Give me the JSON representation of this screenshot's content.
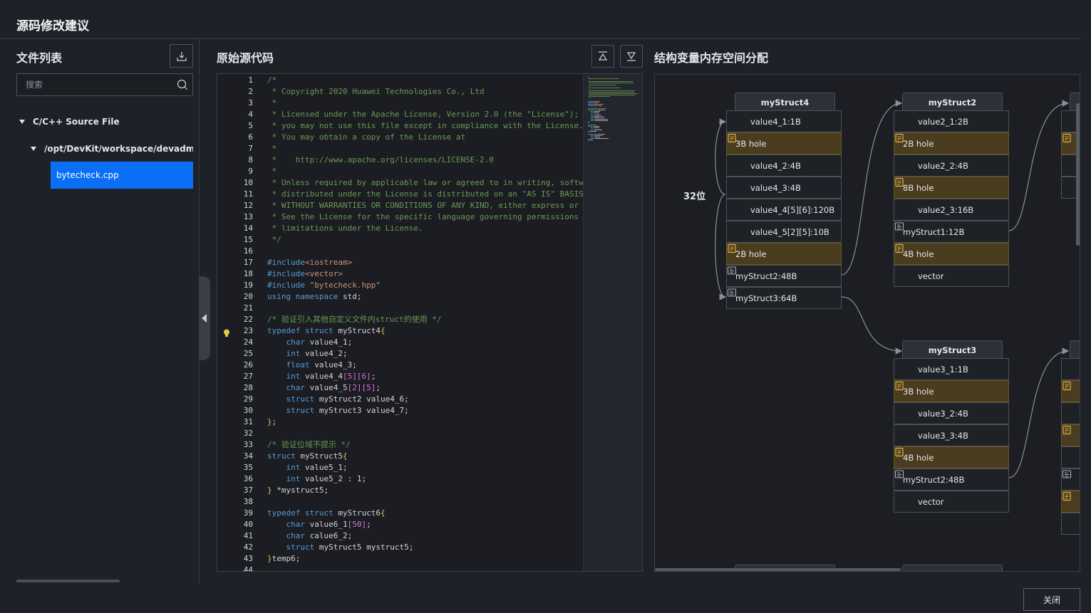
{
  "dialog": {
    "title": "源码修改建议",
    "close_label": "关闭"
  },
  "file_panel": {
    "title": "文件列表",
    "search_placeholder": "搜索",
    "tree": {
      "root_label": "C/C++ Source File",
      "folder_label": "/opt/DevKit/workspace/devadmin/at",
      "selected_file": "bytecheck.cpp"
    }
  },
  "code_panel": {
    "title": "原始源代码",
    "hint_line": 23,
    "lines": [
      [
        [
          "c-cm",
          "/*"
        ]
      ],
      [
        [
          "c-cm",
          " * Copyright 2020 Huawei Technologies Co., Ltd"
        ]
      ],
      [
        [
          "c-cm",
          " *"
        ]
      ],
      [
        [
          "c-cm",
          " * Licensed under the Apache License, Version 2.0 (the \"License\");"
        ]
      ],
      [
        [
          "c-cm",
          " * you may not use this file except in compliance with the License."
        ]
      ],
      [
        [
          "c-cm",
          " * You may obtain a copy of the License at"
        ]
      ],
      [
        [
          "c-cm",
          " *"
        ]
      ],
      [
        [
          "c-cm",
          " *    http://www.apache.org/licenses/LICENSE-2.0"
        ]
      ],
      [
        [
          "c-cm",
          " *"
        ]
      ],
      [
        [
          "c-cm",
          " * Unless required by applicable law or agreed to in writing, software"
        ]
      ],
      [
        [
          "c-cm",
          " * distributed under the License is distributed on an \"AS IS\" BASIS,"
        ]
      ],
      [
        [
          "c-cm",
          " * WITHOUT WARRANTIES OR CONDITIONS OF ANY KIND, either express or implied."
        ]
      ],
      [
        [
          "c-cm",
          " * See the License for the specific language governing permissions and"
        ]
      ],
      [
        [
          "c-cm",
          " * limitations under the License."
        ]
      ],
      [
        [
          "c-cm",
          " */"
        ]
      ],
      [],
      [
        [
          "c-pp",
          "#include"
        ],
        [
          "c-st",
          "<iostream>"
        ]
      ],
      [
        [
          "c-pp",
          "#include"
        ],
        [
          "c-st",
          "<vector>"
        ]
      ],
      [
        [
          "c-pp",
          "#include "
        ],
        [
          "c-st",
          "\"bytecheck.hpp\""
        ]
      ],
      [
        [
          "c-kw",
          "using namespace"
        ],
        [
          "c-tx",
          " std;"
        ]
      ],
      [],
      [
        [
          "c-cm",
          "/* 验证引入其他自定义文件内struct的使用 */"
        ]
      ],
      [
        [
          "c-kw",
          "typedef struct"
        ],
        [
          "c-tx",
          " myStruct4"
        ],
        [
          "c-pu",
          "{"
        ]
      ],
      [
        [
          "c-tx",
          "    "
        ],
        [
          "c-kw",
          "char"
        ],
        [
          "c-tx",
          " value4_1;"
        ]
      ],
      [
        [
          "c-tx",
          "    "
        ],
        [
          "c-kw",
          "int"
        ],
        [
          "c-tx",
          " value4_2;"
        ]
      ],
      [
        [
          "c-tx",
          "    "
        ],
        [
          "c-kw",
          "float"
        ],
        [
          "c-tx",
          " value4_3;"
        ]
      ],
      [
        [
          "c-tx",
          "    "
        ],
        [
          "c-kw",
          "int"
        ],
        [
          "c-tx",
          " value4_4"
        ],
        [
          "c-br",
          "[5][6]"
        ],
        [
          "c-tx",
          ";"
        ]
      ],
      [
        [
          "c-tx",
          "    "
        ],
        [
          "c-kw",
          "char"
        ],
        [
          "c-tx",
          " value4_5"
        ],
        [
          "c-br",
          "[2][5]"
        ],
        [
          "c-tx",
          ";"
        ]
      ],
      [
        [
          "c-tx",
          "    "
        ],
        [
          "c-kw",
          "struct"
        ],
        [
          "c-tx",
          " myStruct2 value4_6;"
        ]
      ],
      [
        [
          "c-tx",
          "    "
        ],
        [
          "c-kw",
          "struct"
        ],
        [
          "c-tx",
          " myStruct3 value4_7;"
        ]
      ],
      [
        [
          "c-pu",
          "}"
        ],
        [
          "c-tx",
          ";"
        ]
      ],
      [],
      [
        [
          "c-cm",
          "/* 验证位域不提示 */"
        ]
      ],
      [
        [
          "c-kw",
          "struct"
        ],
        [
          "c-tx",
          " myStruct5"
        ],
        [
          "c-pu",
          "{"
        ]
      ],
      [
        [
          "c-tx",
          "    "
        ],
        [
          "c-kw",
          "int"
        ],
        [
          "c-tx",
          " value5_1;"
        ]
      ],
      [
        [
          "c-tx",
          "    "
        ],
        [
          "c-kw",
          "int"
        ],
        [
          "c-tx",
          " value5_2 : 1;"
        ]
      ],
      [
        [
          "c-pu",
          "}"
        ],
        [
          "c-tx",
          " *mystruct5;"
        ]
      ],
      [],
      [
        [
          "c-kw",
          "typedef struct"
        ],
        [
          "c-tx",
          " myStruct6"
        ],
        [
          "c-pu",
          "{"
        ]
      ],
      [
        [
          "c-tx",
          "    "
        ],
        [
          "c-kw",
          "char"
        ],
        [
          "c-tx",
          " value6_1"
        ],
        [
          "c-br",
          "[50]"
        ],
        [
          "c-tx",
          ";"
        ]
      ],
      [
        [
          "c-tx",
          "    "
        ],
        [
          "c-kw",
          "char"
        ],
        [
          "c-tx",
          " calue6_2;"
        ]
      ],
      [
        [
          "c-tx",
          "    "
        ],
        [
          "c-kw",
          "struct"
        ],
        [
          "c-tx",
          " myStruct5 mystruct5;"
        ]
      ],
      [
        [
          "c-pu",
          "}"
        ],
        [
          "c-tx",
          "temp6;"
        ]
      ],
      []
    ]
  },
  "struct_panel": {
    "title": "结构变量内存空间分配",
    "bit_label": "32位",
    "structs": [
      {
        "name": "myStruct4",
        "rows": [
          {
            "t": "plain",
            "label": "value4_1:1B"
          },
          {
            "t": "hole",
            "label": "3B hole"
          },
          {
            "t": "plain",
            "label": "value4_2:4B"
          },
          {
            "t": "plain",
            "label": "value4_3:4B"
          },
          {
            "t": "plain",
            "label": "value4_4[5][6]:120B"
          },
          {
            "t": "plain",
            "label": "value4_5[2][5]:10B"
          },
          {
            "t": "hole",
            "label": "2B hole"
          },
          {
            "t": "ref",
            "label": "myStruct2:48B"
          },
          {
            "t": "ref",
            "label": "myStruct3:64B"
          }
        ]
      },
      {
        "name": "myStruct2",
        "rows": [
          {
            "t": "plain",
            "label": "value2_1:2B"
          },
          {
            "t": "hole",
            "label": "2B hole"
          },
          {
            "t": "plain",
            "label": "value2_2:4B"
          },
          {
            "t": "hole",
            "label": "8B hole"
          },
          {
            "t": "plain",
            "label": "value2_3:16B"
          },
          {
            "t": "ref",
            "label": "myStruct1:12B"
          },
          {
            "t": "hole",
            "label": "4B hole"
          },
          {
            "t": "plain",
            "label": "vector"
          }
        ]
      },
      {
        "name": "myStruct3",
        "rows": [
          {
            "t": "plain",
            "label": "value3_1:1B"
          },
          {
            "t": "hole",
            "label": "3B hole"
          },
          {
            "t": "plain",
            "label": "value3_2:4B"
          },
          {
            "t": "plain",
            "label": "value3_3:4B"
          },
          {
            "t": "hole",
            "label": "4B hole"
          },
          {
            "t": "ref",
            "label": "myStruct2:48B"
          },
          {
            "t": "plain",
            "label": "vector"
          }
        ]
      }
    ],
    "partial_right_top": [
      "plain",
      "hole",
      "plain",
      "plain"
    ],
    "partial_right_bottom": [
      "plain",
      "hole",
      "plain",
      "hole",
      "plain",
      "ref",
      "hole",
      "plain"
    ]
  },
  "colors": {
    "accent": "#0a6ff5",
    "hole_bg": "#4a3d1f",
    "hole_icon": "#e0b04a"
  }
}
